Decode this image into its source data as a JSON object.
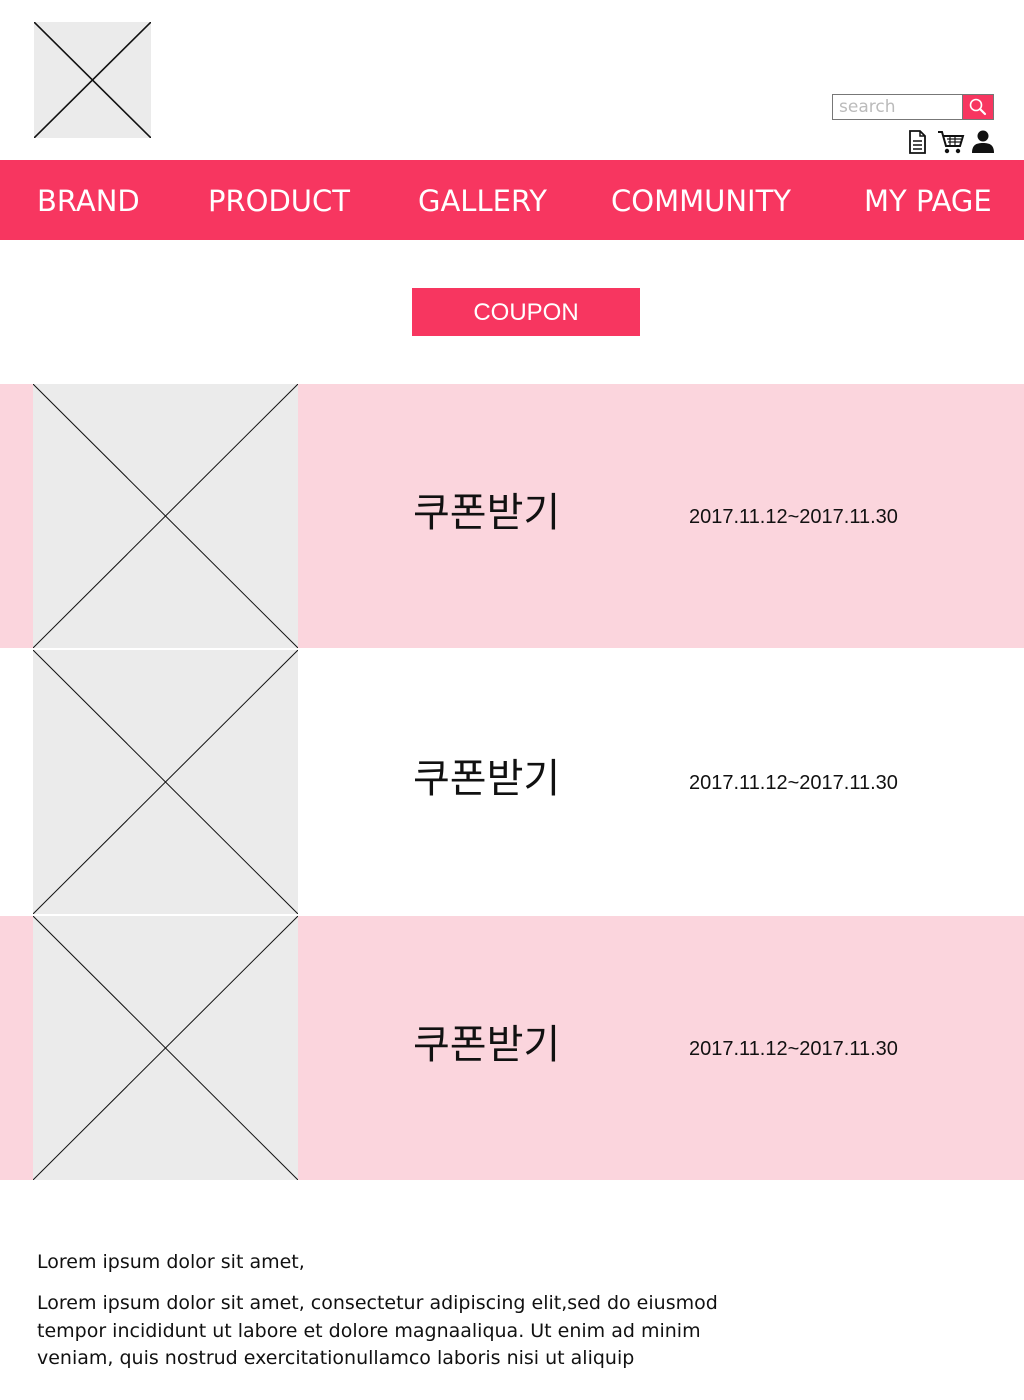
{
  "header": {
    "search": {
      "placeholder": "search",
      "value": ""
    },
    "icons": [
      "document-icon",
      "cart-icon",
      "user-icon"
    ]
  },
  "nav": {
    "items": [
      {
        "label": "BRAND"
      },
      {
        "label": "PRODUCT"
      },
      {
        "label": "GALLERY"
      },
      {
        "label": "COMMUNITY"
      },
      {
        "label": "MY PAGE"
      }
    ]
  },
  "main": {
    "title": "COUPON",
    "coupons": [
      {
        "label": "쿠폰받기",
        "period": "2017.11.12~2017.11.30"
      },
      {
        "label": "쿠폰받기",
        "period": "2017.11.12~2017.11.30"
      },
      {
        "label": "쿠폰받기",
        "period": "2017.11.12~2017.11.30"
      }
    ]
  },
  "footer": {
    "title": "Lorem ipsum dolor sit amet,",
    "body": "Lorem ipsum dolor sit amet, consectetur adipiscing elit,sed do eiusmod tempor incididunt ut labore et dolore magnaaliqua. Ut enim ad minim veniam, quis nostrud exercitationullamco laboris nisi ut aliquip"
  },
  "colors": {
    "accent": "#f73660",
    "row_pink": "#fbd5dd",
    "placeholder_fill": "#ebebeb"
  }
}
